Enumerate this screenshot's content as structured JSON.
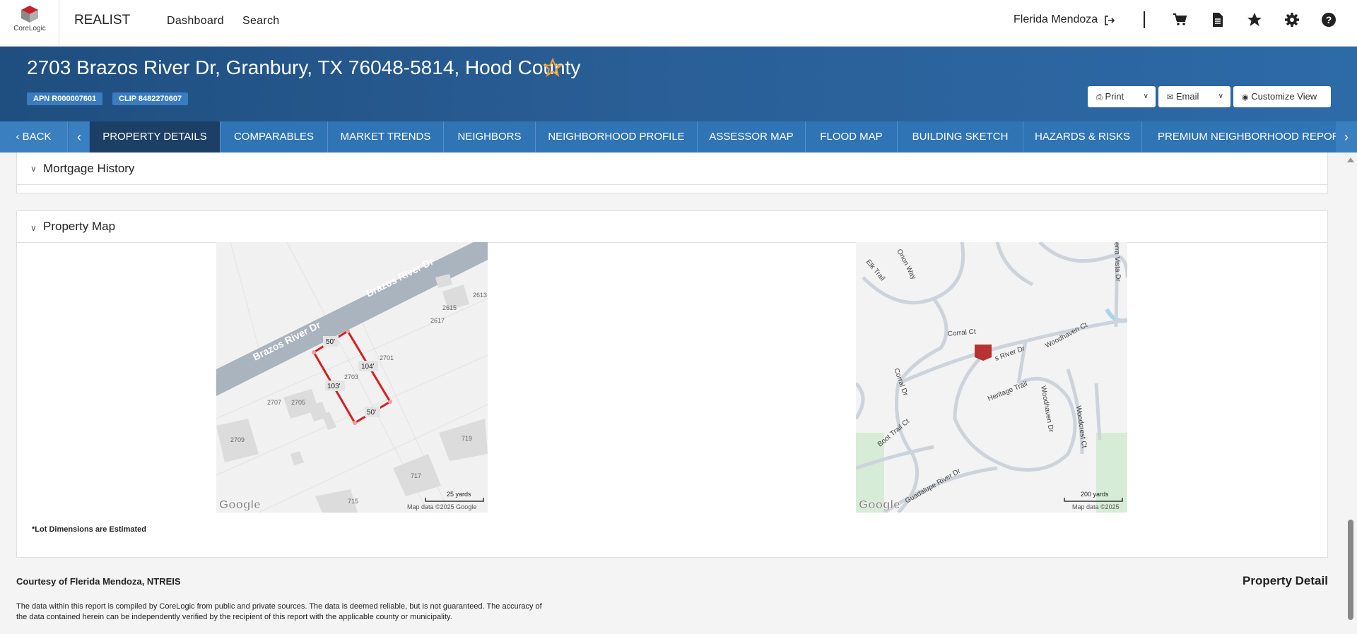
{
  "topbar": {
    "logo_text": "CoreLogic",
    "app_name": "REALIST",
    "nav": [
      "Dashboard",
      "Search"
    ],
    "user_name": "Flerida Mendoza",
    "icons": [
      "logout-icon",
      "cart-icon",
      "document-icon",
      "star-icon",
      "gear-icon",
      "help-icon"
    ]
  },
  "header": {
    "address": "2703 Brazos River Dr, Granbury, TX 76048-5814, Hood County",
    "apn": "APN R000007601",
    "clip": "CLIP 8482270607",
    "print_label": "Print",
    "email_label": "Email",
    "customize_label": "Customize View"
  },
  "tabs": {
    "back": "BACK",
    "items": [
      "PROPERTY DETAILS",
      "COMPARABLES",
      "MARKET TRENDS",
      "NEIGHBORS",
      "NEIGHBORHOOD PROFILE",
      "ASSESSOR MAP",
      "FLOOD MAP",
      "BUILDING SKETCH",
      "HAZARDS & RISKS",
      "PREMIUM NEIGHBORHOOD REPORT"
    ],
    "active": "PROPERTY DETAILS"
  },
  "sections": {
    "mortgage_history": "Mortgage History",
    "property_map": "Property Map"
  },
  "map_left": {
    "street": "Brazos River Dr",
    "street2": "Brazos River Dr",
    "dims": [
      "50'",
      "104'",
      "103'",
      "50'"
    ],
    "lots": [
      "2615",
      "2613",
      "2617",
      "2701",
      "2703",
      "2707",
      "2705",
      "2709",
      "719",
      "717",
      "715"
    ],
    "scale": "25 yards",
    "attribution": "Map data ©2025 Google",
    "google": "Google"
  },
  "map_right": {
    "streets": [
      "Elk Trail",
      "Orion Way",
      "erra Vista Dr",
      "Corral Ct",
      "Woodhaven Ct",
      "s River Dr",
      "Corral Dr",
      "Heritage Trail",
      "Woodhaven Dr",
      "Woodcrest Ct",
      "Boot Trail Ct",
      "Guadalupe River Dr"
    ],
    "scale": "200 yards",
    "attribution": "Map data ©2025",
    "google": "Google"
  },
  "footer": {
    "lot_note": "*Lot Dimensions are Estimated",
    "courtesy": "Courtesy of Flerida Mendoza, NTREIS",
    "report_type": "Property Detail",
    "disclaimer": "The data within this report is compiled by CoreLogic from public and private sources. The data is deemed reliable, but is not guaranteed. The accuracy of the data contained herein can be independently verified by the recipient of this report with the applicable county or municipality."
  }
}
